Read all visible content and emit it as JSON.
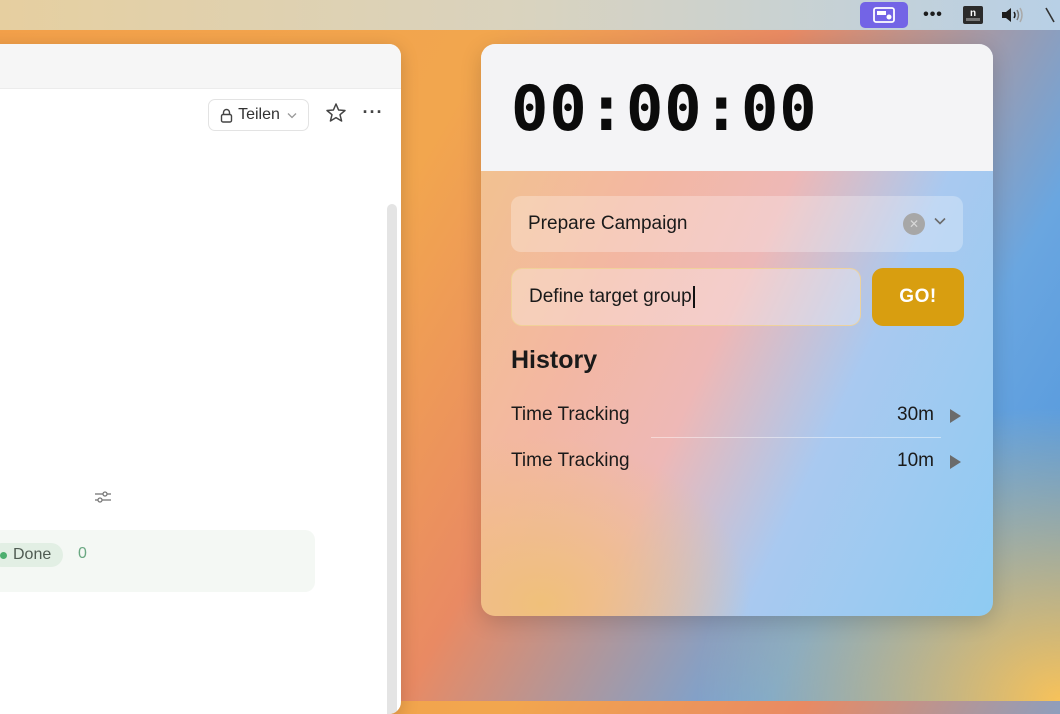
{
  "menubar": {
    "items": [
      "tracker-app-icon",
      "more-icon",
      "notion-icon",
      "volume-icon"
    ],
    "dots_label": "•••",
    "notion_letter": "n"
  },
  "left_window": {
    "share_label": "Teilen",
    "more_label": "···",
    "status": {
      "label": "Done",
      "count": "0"
    }
  },
  "timer": {
    "display": "00:00:00",
    "project": "Prepare Campaign",
    "task_value": "Define target group",
    "go_label": "GO!",
    "history_title": "History",
    "history": [
      {
        "label": "Time Tracking",
        "duration": "30m"
      },
      {
        "label": "Time Tracking",
        "duration": "10m"
      }
    ]
  },
  "colors": {
    "go_button": "#d89e10",
    "menubar_active": "#7364e6",
    "done_dot": "#4caf6e"
  }
}
